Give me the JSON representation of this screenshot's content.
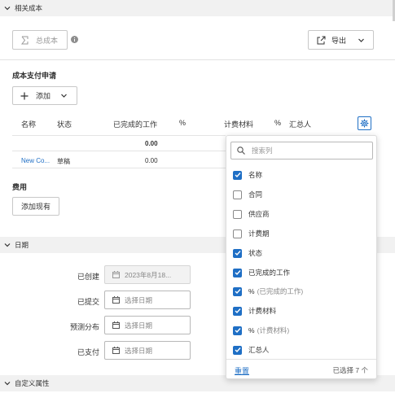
{
  "related_costs": {
    "section_title": "相关成本",
    "total_cost_button": "总成本",
    "export_button": "导出"
  },
  "cost_payment": {
    "title": "成本支付申请",
    "add_button": "添加",
    "columns": [
      "名称",
      "状态",
      "已完成的工作",
      "%",
      "计费材料",
      "%",
      "汇总人"
    ],
    "total_row": {
      "completed_work": "0.00"
    },
    "rows": [
      {
        "name": "New Co...",
        "status": "草稿",
        "completed_work": "0.00"
      }
    ]
  },
  "fees": {
    "title": "费用",
    "add_existing_button": "添加现有"
  },
  "dates": {
    "section_title": "日期",
    "fields": [
      {
        "label": "已创建",
        "value": "2023年8月18...",
        "disabled": true
      },
      {
        "label": "已提交",
        "placeholder": "选择日期"
      },
      {
        "label": "预测分布",
        "placeholder": "选择日期"
      },
      {
        "label": "已支付",
        "placeholder": "选择日期"
      }
    ]
  },
  "custom_props": {
    "section_title": "自定义属性"
  },
  "column_picker": {
    "search_placeholder": "搜索列",
    "options": [
      {
        "label": "名称",
        "checked": true
      },
      {
        "label": "合同",
        "checked": false
      },
      {
        "label": "供应商",
        "checked": false
      },
      {
        "label": "计费期",
        "checked": false
      },
      {
        "label": "状态",
        "checked": true
      },
      {
        "label": "已完成的工作",
        "checked": true
      },
      {
        "label": "%",
        "suffix": "(已完成的工作)",
        "checked": true
      },
      {
        "label": "计费材料",
        "checked": true
      },
      {
        "label": "%",
        "suffix": "(计费材料)",
        "checked": true
      },
      {
        "label": "汇总人",
        "checked": true
      }
    ],
    "reset_label": "重置",
    "selected_count": "已选择 7 个"
  },
  "colors": {
    "accent": "#1f6fc5",
    "link": "#1f6fc5"
  }
}
